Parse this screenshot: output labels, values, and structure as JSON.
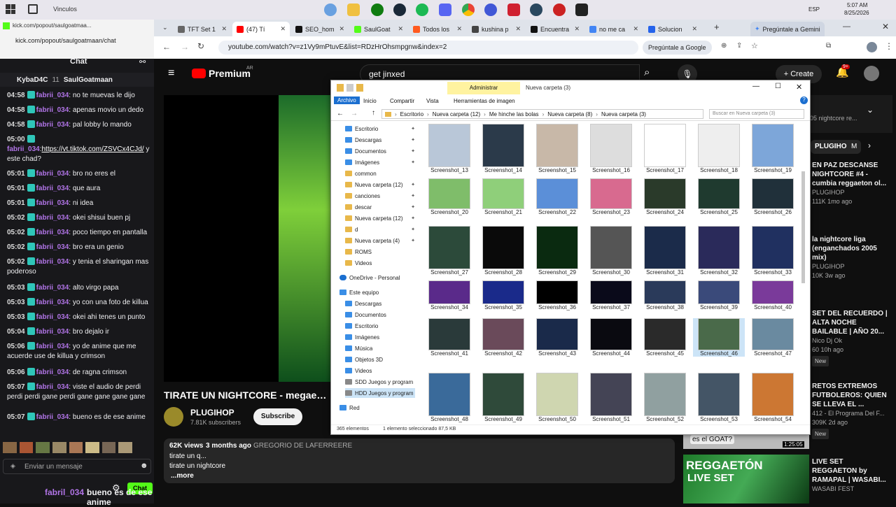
{
  "os": {
    "clock_time": "5:07 AM",
    "clock_date": "8/25/2026",
    "lang": "ESP",
    "app_label": "Vinculos"
  },
  "popup": {
    "title": "kick.com/popout/saulgoatmaa...",
    "url": "kick.com/popout/saulgoatmaan/chat"
  },
  "tabs": [
    {
      "label": "TFT Set 1",
      "color": "#666"
    },
    {
      "label": "(47) Tí",
      "color": "#ff0000"
    },
    {
      "label": "SEO_hom",
      "color": "#111"
    },
    {
      "label": "SaulGoat",
      "color": "#53fc18"
    },
    {
      "label": "Todos los",
      "color": "#ff5a1f"
    },
    {
      "label": "kushina p",
      "color": "#444"
    },
    {
      "label": "Encuentra",
      "color": "#111"
    },
    {
      "label": "no me ca",
      "color": "#4285f4"
    },
    {
      "label": "Solucion",
      "color": "#2563eb"
    }
  ],
  "gemini_tab": "Pregúntale a Gemini",
  "address": {
    "url": "youtube.com/watch?v=z1Vy9mPtuvE&list=RDzHrOhsmpgnw&index=2",
    "ask_google": "Pregúntale a Google"
  },
  "chat": {
    "title": "Chat",
    "top_user1": "KybaD4C",
    "top_count1": "11",
    "top_user2": "SaulGoatmaan",
    "input_placeholder": "Enviar un mensaje",
    "send_label": "Chat",
    "footer_user": "fabril_034",
    "footer_text": "bueno es de ese anime",
    "messages": [
      {
        "time": "04:58",
        "user": "fabrii_034",
        "text": ": no te muevas le dijo"
      },
      {
        "time": "04:58",
        "user": "fabrii_034",
        "text": ": apenas movio un dedo"
      },
      {
        "time": "04:58",
        "user": "fabrii_034",
        "text": ": pal lobby lo mando"
      },
      {
        "time": "05:00",
        "user": "fabrii_034",
        "text": ":",
        "link": "https://vt.tiktok.com/ZSVCx4CJd/",
        "text2": " y este chad?"
      },
      {
        "time": "05:01",
        "user": "fabrii_034",
        "text": ": bro no eres el"
      },
      {
        "time": "05:01",
        "user": "fabrii_034",
        "text": ": que aura"
      },
      {
        "time": "05:01",
        "user": "fabrii_034",
        "text": ": ni idea"
      },
      {
        "time": "05:02",
        "user": "fabrii_034",
        "text": ": okei shisui buen pj"
      },
      {
        "time": "05:02",
        "user": "fabrii_034",
        "text": ": poco tiempo en pantalla"
      },
      {
        "time": "05:02",
        "user": "fabrii_034",
        "text": ": bro era un genio"
      },
      {
        "time": "05:02",
        "user": "fabrii_034",
        "text": ": y tenia el sharingan mas poderoso"
      },
      {
        "time": "05:03",
        "user": "fabrii_034",
        "text": ": alto virgo papa"
      },
      {
        "time": "05:03",
        "user": "fabrii_034",
        "text": ": yo con una foto de killua"
      },
      {
        "time": "05:03",
        "user": "fabrii_034",
        "text": ": okei ahi tenes un punto"
      },
      {
        "time": "05:04",
        "user": "fabrii_034",
        "text": ": bro dejalo ir"
      },
      {
        "time": "05:06",
        "user": "fabrii_034",
        "text": ": yo de anime que me acuerde use de killua y crimson"
      },
      {
        "time": "05:06",
        "user": "fabrii_034",
        "text": ": de ragna crimson"
      },
      {
        "time": "05:07",
        "user": "fabrii_034",
        "text": ": viste el audio de perdi perdi perdi gane perdi gane gane gane gane"
      },
      {
        "time": "05:07",
        "user": "fabrii_034",
        "text": ": bueno es de ese anime"
      }
    ]
  },
  "youtube": {
    "logo": "Premium",
    "region": "AR",
    "search": "get jinxed",
    "create": "Create",
    "notif": "9+",
    "video_title": "TIRATE UN NIGHTCORE - megaexito",
    "channel": "PLUGIHOP",
    "subs": "7.81K subscribers",
    "subscribe": "Subscribe",
    "views": "62K views",
    "ago": "3 months ago",
    "extra": "GREGORIO DE LAFERREERE",
    "desc1": "tirate un q...",
    "desc2": "tirate un nightcore",
    "more": "...more",
    "chips": [
      "PLUGIHOP",
      "M"
    ],
    "playlist_snip": "05 nightcore re...",
    "side_videos": [
      {
        "title": "EN PAZ DESCANSE NIGHTCORE #4 - cumbia reggaeton ol...",
        "channel": "PLUGIHOP",
        "meta": "111K  1mo ago"
      },
      {
        "title": "la nightcore liga (enganchados 2005 mix)",
        "channel": "PLUGIHOP",
        "meta": "10K  3w ago"
      },
      {
        "title": "SET DEL RECUERDO | ALTA NOCHE BAILABLE | AÑO 20...",
        "channel": "Nico Dj Ok",
        "meta": "60  10h ago",
        "badge": "New"
      },
      {
        "title": "RETOS EXTREMOS FUTBOLEROS: QUIEN SE LLEVA EL ...",
        "channel": "412 - El Programa Del F...",
        "meta": "309K  2d ago",
        "badge": "New"
      },
      {
        "title": "LIVE SET REGGAETON by RAMAPAL | WASABI...",
        "channel": "WASABI FEST",
        "meta": ""
      }
    ],
    "thumb_text1": "es el GOAT?",
    "thumb_dur": "1:25:05",
    "thumb_text2": "REGGAETÓN",
    "thumb_text3": "LIVE SET"
  },
  "explorer": {
    "title": "Nueva carpeta (3)",
    "manage": "Administrar",
    "ribbon": [
      "Archivo",
      "Inicio",
      "Compartir",
      "Vista",
      "Herramientas de imagen"
    ],
    "path": [
      "Escritorio",
      "Nueva carpeta (12)",
      "Me hinche las bolas",
      "Nueva carpeta (8)",
      "Nueva carpeta (3)"
    ],
    "search_ph": "Buscar en Nueva carpeta (3)",
    "sidebar": [
      "Escritorio",
      "Descargas",
      "Documentos",
      "Imágenes",
      "common",
      "Nueva carpeta (12)",
      "canciones",
      "descar",
      "Nueva carpeta (12)",
      "d",
      "Nueva carpeta (4)",
      "ROMS",
      "Videos"
    ],
    "onedrive": "OneDrive - Personal",
    "this_pc": "Este equipo",
    "pc_items": [
      "Descargas",
      "Documentos",
      "Escritorio",
      "Imágenes",
      "Música",
      "Objetos 3D",
      "Videos",
      "SDD Juegos y program",
      "HDD Juegos y program"
    ],
    "network": "Red",
    "status_count": "365 elementos",
    "status_sel": "1 elemento seleccionado  87,5 KB",
    "files": [
      13,
      14,
      15,
      16,
      17,
      18,
      19,
      20,
      21,
      22,
      23,
      24,
      25,
      26,
      27,
      28,
      29,
      30,
      31,
      32,
      33,
      34,
      35,
      36,
      37,
      38,
      39,
      40,
      41,
      42,
      43,
      44,
      45,
      46,
      47,
      48,
      49,
      50,
      51,
      52,
      53,
      54
    ],
    "file_prefix": "Screenshot_"
  }
}
